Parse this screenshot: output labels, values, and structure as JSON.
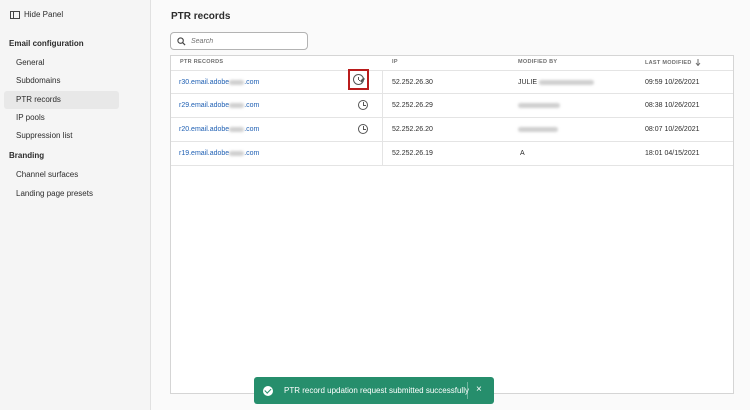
{
  "sidebar": {
    "hide_panel_label": "Hide Panel",
    "email_section": "Email configuration",
    "email_items": [
      {
        "label": "General"
      },
      {
        "label": "Subdomains"
      },
      {
        "label": "PTR records"
      },
      {
        "label": "IP pools"
      },
      {
        "label": "Suppression list"
      }
    ],
    "branding_section": "Branding",
    "branding_items": [
      {
        "label": "Channel surfaces"
      },
      {
        "label": "Landing page presets"
      }
    ]
  },
  "page": {
    "title": "PTR records",
    "search_placeholder": "Search"
  },
  "table": {
    "columns": {
      "ptr": "PTR RECORDS",
      "ip": "IP",
      "modified_by": "MODIFIED BY",
      "last_modified": "LAST MODIFIED"
    },
    "rows": [
      {
        "ptr_prefix": "r30.email.adobe",
        "ptr_suffix": ".com",
        "ip": "52.252.26.30",
        "modified_by": "JULIE",
        "last_modified": "09:59 10/26/2021"
      },
      {
        "ptr_prefix": "r29.email.adobe",
        "ptr_suffix": ".com",
        "ip": "52.252.26.29",
        "modified_by": "",
        "last_modified": "08:38 10/26/2021"
      },
      {
        "ptr_prefix": "r20.email.adobe",
        "ptr_suffix": ".com",
        "ip": "52.252.26.20",
        "modified_by": "",
        "last_modified": "08:07 10/26/2021"
      },
      {
        "ptr_prefix": "r19.email.adobe",
        "ptr_suffix": ".com",
        "ip": "52.252.26.19",
        "modified_by": "A",
        "last_modified": "18:01 04/15/2021"
      }
    ]
  },
  "toast": {
    "message": "PTR record updation request submitted successfully",
    "close": "×"
  },
  "colors": {
    "link": "#1e5fb3",
    "toast_bg": "#268e6c",
    "highlight": "#b91c1c"
  },
  "icons": [
    "panel-icon",
    "search-icon",
    "clock-edit-icon",
    "clock-icon",
    "sort-arrow-icon",
    "check-circle-icon",
    "close-icon"
  ]
}
